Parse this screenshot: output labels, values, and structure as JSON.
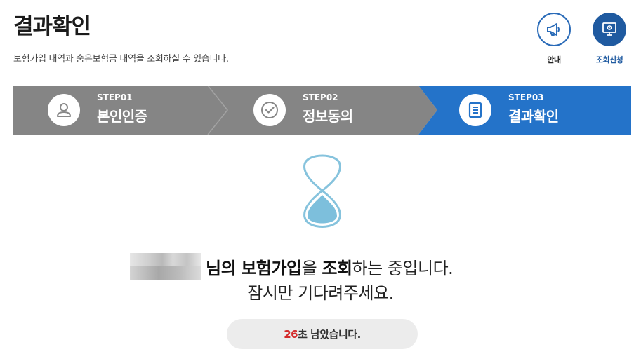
{
  "header": {
    "title": "결과확인",
    "description": "보험가입 내역과 숨은보험금 내역을 조회하실 수 있습니다."
  },
  "top_buttons": [
    {
      "label": "안내",
      "icon": "megaphone-icon"
    },
    {
      "label": "조회신청",
      "icon": "monitor-icon"
    }
  ],
  "steps": [
    {
      "number": "STEP01",
      "name": "본인인증",
      "icon": "person-icon",
      "active": false
    },
    {
      "number": "STEP02",
      "name": "정보동의",
      "icon": "check-icon",
      "active": false
    },
    {
      "number": "STEP03",
      "name": "결과확인",
      "icon": "document-icon",
      "active": true
    }
  ],
  "colors": {
    "step_inactive": "#858585",
    "step_active": "#2473c9",
    "accent": "#1f5aa0",
    "timer_count": "#d42b2b"
  },
  "status": {
    "name_suffix": "님의",
    "subject": "보험가입",
    "particle": "을",
    "action": "조회",
    "tail": "하는 중입니다.",
    "line2": "잠시만 기다려주세요."
  },
  "timer": {
    "seconds": "26",
    "text": "초 남았습니다."
  }
}
